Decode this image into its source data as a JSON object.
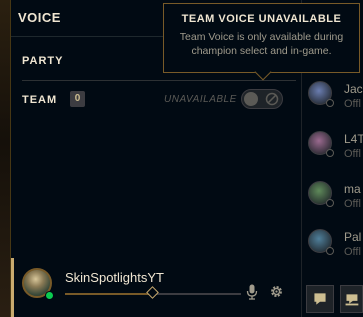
{
  "voice": {
    "title": "VOICE",
    "party_label": "PARTY",
    "team_label": "TEAM",
    "team_count": "0",
    "team_status": "UNAVAILABLE"
  },
  "tooltip": {
    "title": "TEAM VOICE UNAVAILABLE",
    "body": "Team Voice is only available during champion select and in-game."
  },
  "user": {
    "name": "SkinSpotlightsYT",
    "status_color": "#0acb50",
    "volume": 0.5
  },
  "friends": [
    {
      "name": "Jac",
      "status": "Offl",
      "avatar_color": "#6a7db0"
    },
    {
      "name": "L4T",
      "status": "Offl",
      "avatar_color": "#9b6a8f"
    },
    {
      "name": "ma",
      "status": "Offl",
      "avatar_color": "#5f8a5a"
    },
    {
      "name": "Pal",
      "status": "Offl",
      "avatar_color": "#4f7f9a"
    }
  ],
  "colors": {
    "gold": "#c8aa6e",
    "gold_dark": "#785a28",
    "text_light": "#f0e6d2",
    "text_muted": "#5b5a56",
    "background": "#010a13"
  }
}
